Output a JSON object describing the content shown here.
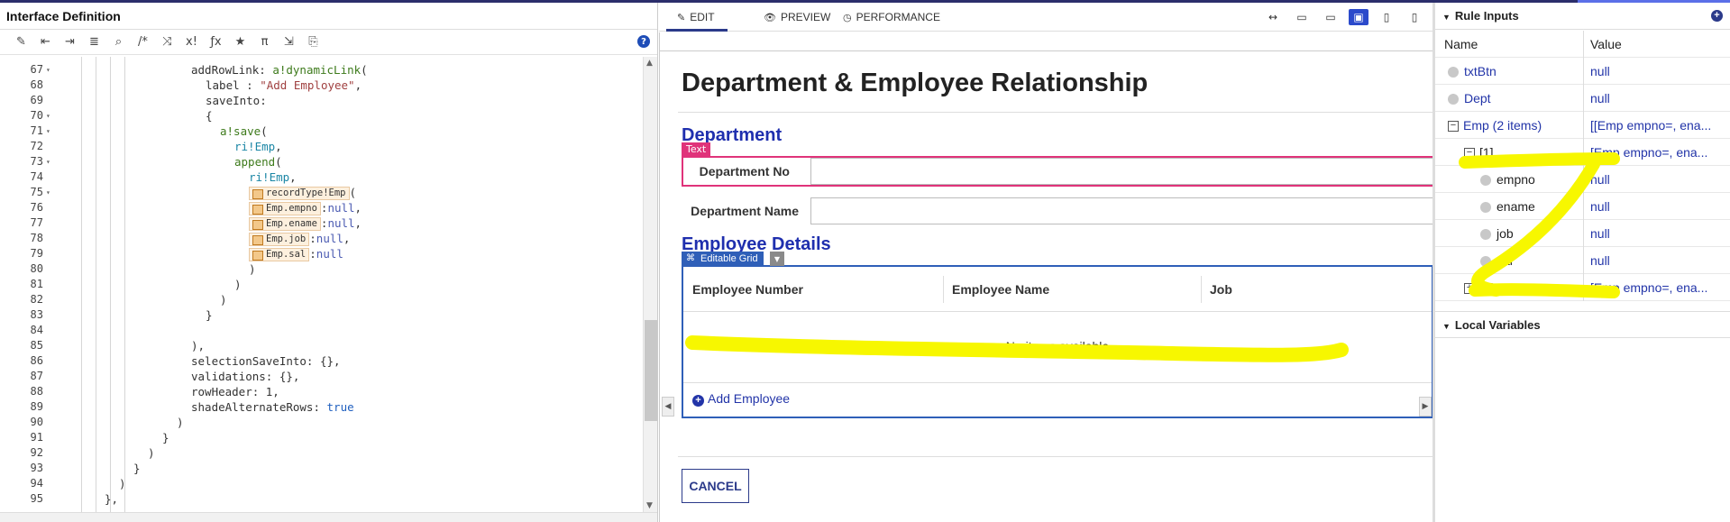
{
  "left_panel": {
    "title": "Interface Definition",
    "toolbar_icons": [
      {
        "name": "auto-format-icon",
        "glyph": "✎"
      },
      {
        "name": "outdent-icon",
        "glyph": "⇤"
      },
      {
        "name": "indent-icon",
        "glyph": "⇥"
      },
      {
        "name": "list-icon",
        "glyph": "≣"
      },
      {
        "name": "search-icon",
        "glyph": "⌕"
      },
      {
        "name": "comment-icon",
        "glyph": "/*"
      },
      {
        "name": "shuffle-icon",
        "glyph": "⤨"
      },
      {
        "name": "expression-icon",
        "glyph": "x!"
      },
      {
        "name": "function-icon",
        "glyph": "ƒx"
      },
      {
        "name": "star-icon",
        "glyph": "★"
      },
      {
        "name": "pi-icon",
        "glyph": "π"
      },
      {
        "name": "exit-icon",
        "glyph": "⇲"
      },
      {
        "name": "test-icon",
        "glyph": "⎘"
      }
    ],
    "help_glyph": "?",
    "lines": [
      {
        "n": "67",
        "fold": "▾",
        "indent": 6,
        "parts": [
          {
            "t": "addRowLink: ",
            "c": ""
          },
          {
            "t": "a!dynamicLink",
            "c": "k-fn"
          },
          {
            "t": "(",
            "c": ""
          }
        ]
      },
      {
        "n": "68",
        "fold": "",
        "indent": 7,
        "parts": [
          {
            "t": "label : ",
            "c": ""
          },
          {
            "t": "\"Add Employee\"",
            "c": "k-str"
          },
          {
            "t": ",",
            "c": ""
          }
        ]
      },
      {
        "n": "69",
        "fold": "",
        "indent": 7,
        "parts": [
          {
            "t": "saveInto:",
            "c": ""
          }
        ]
      },
      {
        "n": "70",
        "fold": "▾",
        "indent": 7,
        "parts": [
          {
            "t": "{",
            "c": ""
          }
        ]
      },
      {
        "n": "71",
        "fold": "▾",
        "indent": 8,
        "parts": [
          {
            "t": "a!save",
            "c": "k-fn"
          },
          {
            "t": "(",
            "c": ""
          }
        ]
      },
      {
        "n": "72",
        "fold": "",
        "indent": 9,
        "parts": [
          {
            "t": "ri!Emp",
            "c": "k-var"
          },
          {
            "t": ",",
            "c": ""
          }
        ]
      },
      {
        "n": "73",
        "fold": "▾",
        "indent": 9,
        "parts": [
          {
            "t": "append",
            "c": "k-fn"
          },
          {
            "t": "(",
            "c": ""
          }
        ]
      },
      {
        "n": "74",
        "fold": "",
        "indent": 10,
        "parts": [
          {
            "t": "ri!Emp",
            "c": "k-var"
          },
          {
            "t": ",",
            "c": ""
          }
        ]
      },
      {
        "n": "75",
        "fold": "▾",
        "indent": 10,
        "parts": [
          {
            "t": "recordType!Emp",
            "c": "chip"
          },
          {
            "t": "(",
            "c": ""
          }
        ]
      },
      {
        "n": "76",
        "fold": "",
        "indent": 10,
        "parts": [
          {
            "t": "Emp.empno",
            "c": "chip"
          },
          {
            "t": ":",
            "c": ""
          },
          {
            "t": "null",
            "c": "k-kw"
          },
          {
            "t": ",",
            "c": ""
          }
        ]
      },
      {
        "n": "77",
        "fold": "",
        "indent": 10,
        "parts": [
          {
            "t": "Emp.ename",
            "c": "chip"
          },
          {
            "t": ":",
            "c": ""
          },
          {
            "t": "null",
            "c": "k-kw"
          },
          {
            "t": ",",
            "c": ""
          }
        ]
      },
      {
        "n": "78",
        "fold": "",
        "indent": 10,
        "parts": [
          {
            "t": "Emp.job",
            "c": "chip"
          },
          {
            "t": ":",
            "c": ""
          },
          {
            "t": "null",
            "c": "k-kw"
          },
          {
            "t": ",",
            "c": ""
          }
        ]
      },
      {
        "n": "79",
        "fold": "",
        "indent": 10,
        "parts": [
          {
            "t": "Emp.sal",
            "c": "chip"
          },
          {
            "t": ":",
            "c": ""
          },
          {
            "t": "null",
            "c": "k-kw"
          }
        ]
      },
      {
        "n": "80",
        "fold": "",
        "indent": 10,
        "parts": [
          {
            "t": ")",
            "c": ""
          }
        ]
      },
      {
        "n": "81",
        "fold": "",
        "indent": 9,
        "parts": [
          {
            "t": ")",
            "c": ""
          }
        ]
      },
      {
        "n": "82",
        "fold": "",
        "indent": 8,
        "parts": [
          {
            "t": ")",
            "c": ""
          }
        ]
      },
      {
        "n": "83",
        "fold": "",
        "indent": 7,
        "parts": [
          {
            "t": "}",
            "c": ""
          }
        ]
      },
      {
        "n": "84",
        "fold": "",
        "indent": 6,
        "parts": []
      },
      {
        "n": "85",
        "fold": "",
        "indent": 6,
        "parts": [
          {
            "t": "),",
            "c": ""
          }
        ]
      },
      {
        "n": "86",
        "fold": "",
        "indent": 6,
        "parts": [
          {
            "t": "selectionSaveInto: {},",
            "c": ""
          }
        ]
      },
      {
        "n": "87",
        "fold": "",
        "indent": 6,
        "parts": [
          {
            "t": "validations: {},",
            "c": ""
          }
        ]
      },
      {
        "n": "88",
        "fold": "",
        "indent": 6,
        "parts": [
          {
            "t": "rowHeader: 1,",
            "c": ""
          }
        ]
      },
      {
        "n": "89",
        "fold": "",
        "indent": 6,
        "parts": [
          {
            "t": "shadeAlternateRows: ",
            "c": ""
          },
          {
            "t": "true",
            "c": "k-bool"
          }
        ]
      },
      {
        "n": "90",
        "fold": "",
        "indent": 5,
        "parts": [
          {
            "t": ")",
            "c": ""
          }
        ]
      },
      {
        "n": "91",
        "fold": "",
        "indent": 4,
        "parts": [
          {
            "t": "}",
            "c": ""
          }
        ]
      },
      {
        "n": "92",
        "fold": "",
        "indent": 3,
        "parts": [
          {
            "t": ")",
            "c": ""
          }
        ]
      },
      {
        "n": "93",
        "fold": "",
        "indent": 2,
        "parts": [
          {
            "t": "}",
            "c": ""
          }
        ]
      },
      {
        "n": "94",
        "fold": "",
        "indent": 1,
        "parts": [
          {
            "t": ")",
            "c": ""
          }
        ]
      },
      {
        "n": "95",
        "fold": "",
        "indent": 0,
        "parts": [
          {
            "t": "},",
            "c": ""
          }
        ]
      }
    ]
  },
  "center_panel": {
    "tabs": [
      {
        "icon": "✎",
        "label": "EDIT",
        "active": true
      },
      {
        "icon": "👁",
        "label": "PREVIEW",
        "active": false
      },
      {
        "icon": "◷",
        "label": "PERFORMANCE",
        "active": false
      }
    ],
    "device_icons": [
      {
        "name": "fit-width-icon",
        "glyph": "↔"
      },
      {
        "name": "desktop-wide-icon",
        "glyph": "▭"
      },
      {
        "name": "desktop-icon",
        "glyph": "▭"
      },
      {
        "name": "tablet-landscape-icon",
        "glyph": "▣",
        "selected": true
      },
      {
        "name": "tablet-portrait-icon",
        "glyph": "▯"
      },
      {
        "name": "phone-icon",
        "glyph": "▯"
      }
    ],
    "page_title": "Department & Employee Relationship",
    "department_heading": "Department",
    "text_selection_label": "Text",
    "fields": [
      {
        "label": "Department No",
        "value": ""
      },
      {
        "label": "Department Name",
        "value": ""
      }
    ],
    "employee_heading": "Employee Details",
    "grid_tag": "Editable Grid",
    "grid_columns": [
      "Employee Number",
      "Employee Name",
      "Job"
    ],
    "empty_text": "No items available",
    "add_link": "Add Employee",
    "cancel_label": "CANCEL",
    "colors": {
      "accent": "#2b3a8a",
      "heading": "#1f2fae",
      "selection": "#e0337a",
      "grid_border": "#2f5fb8"
    }
  },
  "right_panel": {
    "rule_inputs_title": "Rule Inputs",
    "columns": [
      "Name",
      "Value"
    ],
    "rows": [
      {
        "name": "txtBtn",
        "value": "null",
        "kind": "dot",
        "level": 0
      },
      {
        "name": "Dept",
        "value": "null",
        "kind": "dot",
        "level": 0
      },
      {
        "name": "Emp (2 items)",
        "value": "[[Emp empno=, ena...",
        "kind": "minus",
        "level": 0
      },
      {
        "name": "[1]",
        "value": "[Emp empno=, ena...",
        "kind": "minus",
        "level": 1
      },
      {
        "name": "empno",
        "value": "null",
        "kind": "dot",
        "level": 2
      },
      {
        "name": "ename",
        "value": "null",
        "kind": "dot",
        "level": 2
      },
      {
        "name": "job",
        "value": "null",
        "kind": "dot",
        "level": 2
      },
      {
        "name": "sal",
        "value": "null",
        "kind": "dot",
        "level": 2
      },
      {
        "name": "[2]",
        "value": "[Emp empno=, ena...",
        "kind": "plus",
        "level": 1
      }
    ],
    "local_variables_title": "Local Variables"
  }
}
